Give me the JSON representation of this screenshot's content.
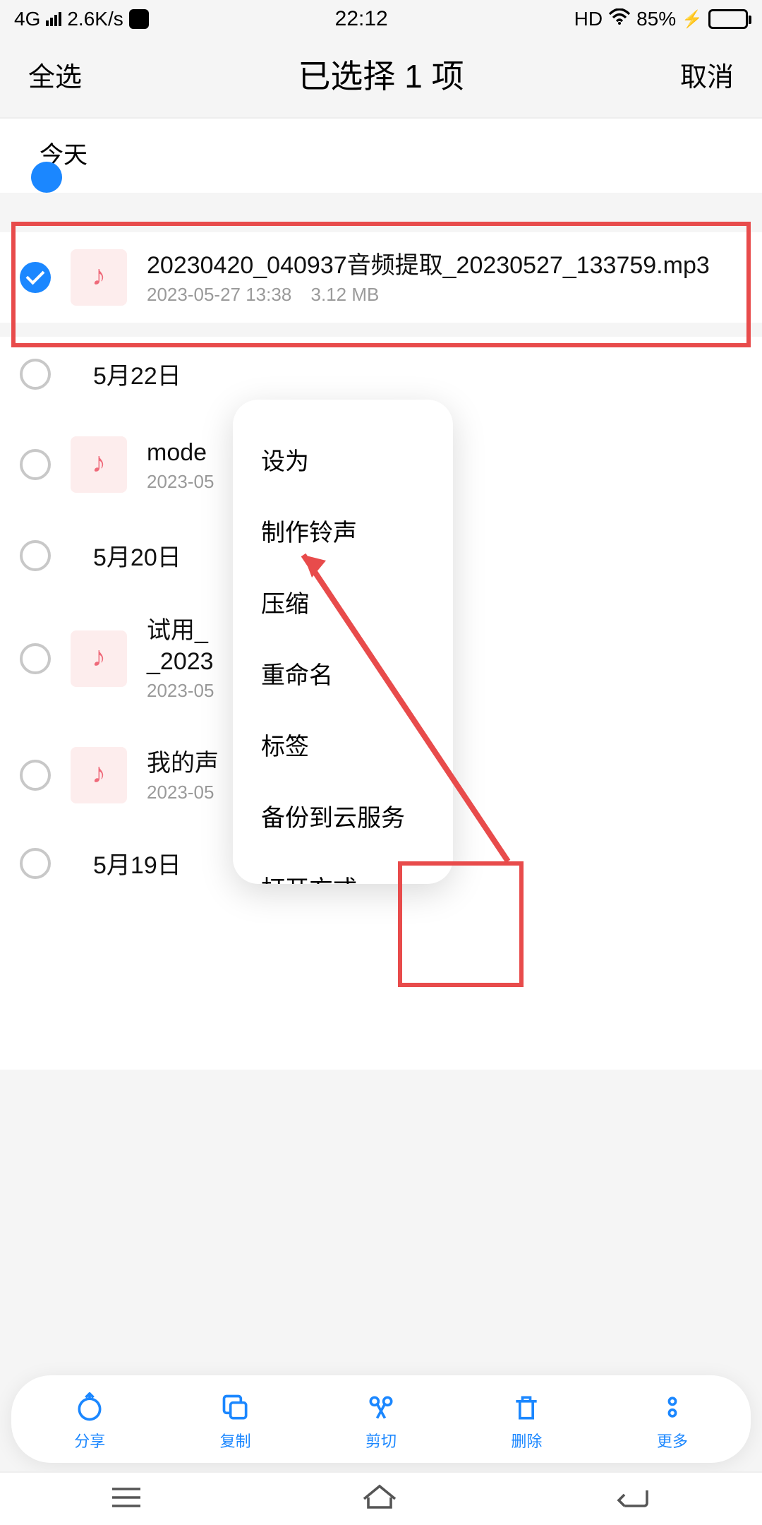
{
  "status": {
    "network": "4G",
    "speed": "2.6K/s",
    "time": "22:12",
    "hd": "HD",
    "battery_pct": "85%"
  },
  "header": {
    "select_all": "全选",
    "title": "已选择 1 项",
    "cancel": "取消"
  },
  "sections": {
    "today": "今天",
    "files": [
      {
        "name": "20230420_040937音频提取_20230527_133759.mp3",
        "date": "2023-05-27 13:38",
        "size": "3.12 MB",
        "selected": true
      }
    ],
    "d0522": "5月22日",
    "d0522_files": [
      {
        "name": "mode",
        "date": "2023-05"
      }
    ],
    "d0520": "5月20日",
    "d0520_files": [
      {
        "name": "试用_",
        "name2": "_2023",
        "date": "2023-05"
      },
      {
        "name": "我的声",
        "date": "2023-05"
      }
    ],
    "d0519": "5月19日"
  },
  "popup": {
    "items": [
      "设为",
      "制作铃声",
      "压缩",
      "重命名",
      "标签",
      "备份到云服务",
      "打开方式"
    ]
  },
  "toolbar": {
    "share": "分享",
    "copy": "复制",
    "cut": "剪切",
    "delete": "删除",
    "more": "更多"
  }
}
